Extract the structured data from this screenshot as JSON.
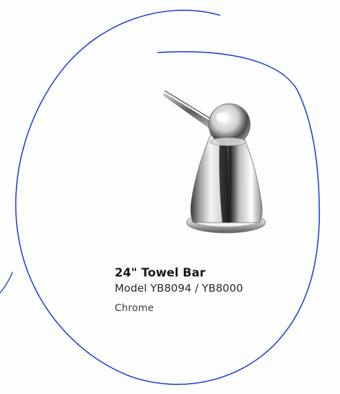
{
  "product": {
    "name": "24\" Towel Bar",
    "model": "Model YB8094 / YB8000",
    "finish": "Chrome"
  },
  "colors": {
    "outline_ink": "#1f3fd6",
    "chrome_dark": "#2b2b2b",
    "chrome_light": "#f2f2f2"
  },
  "icons": {
    "photo": "towel-bar-post-photo",
    "annotation": "hand-drawn-ink-loop"
  }
}
